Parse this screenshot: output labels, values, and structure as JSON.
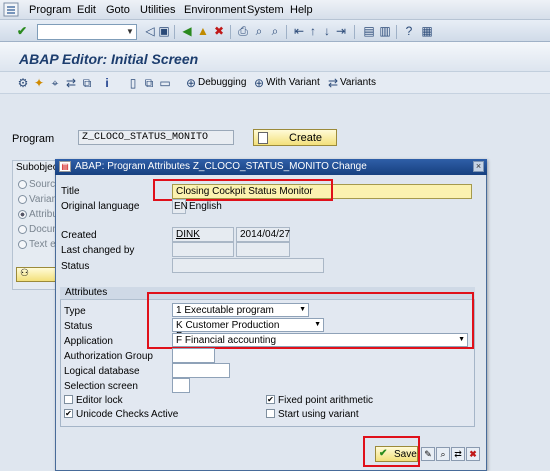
{
  "menu": [
    "Program",
    "Edit",
    "Goto",
    "Utilities",
    "Environment",
    "System",
    "Help"
  ],
  "screen_title": "ABAP Editor: Initial Screen",
  "app_toolbar": {
    "debugging": "Debugging",
    "with_variant": "With Variant",
    "variants": "Variants"
  },
  "main": {
    "program_label": "Program",
    "program_value": "Z_CLOCO_STATUS_MONITO",
    "create_label": "Create",
    "subobjects_title": "Subobject",
    "subobjects": [
      "Source",
      "Variants",
      "Attributes",
      "Documentation",
      "Text elements"
    ],
    "selected_subobject": "Attributes"
  },
  "dialog": {
    "title": "ABAP: Program Attributes Z_CLOCO_STATUS_MONITO Change",
    "title_label": "Title",
    "title_value": "Closing Cockpit Status Monitor",
    "orig_lang_label": "Original language",
    "orig_lang_code": "EN",
    "orig_lang_name": "English",
    "created_label": "Created",
    "created_by": "DINK",
    "created_date": "2014/04/27",
    "last_changed_label": "Last changed by",
    "status_label": "Status",
    "attributes_header": "Attributes",
    "type_label": "Type",
    "type_value": "1 Executable program",
    "status2_label": "Status",
    "status2_value": "K Customer Production Program",
    "application_label": "Application",
    "application_value": "F Financial accounting",
    "auth_group_label": "Authorization Group",
    "logical_db_label": "Logical database",
    "selection_screen_label": "Selection screen",
    "editor_lock_label": "Editor lock",
    "editor_lock_checked": false,
    "fixed_point_label": "Fixed point arithmetic",
    "fixed_point_checked": true,
    "unicode_label": "Unicode Checks Active",
    "unicode_checked": true,
    "start_variant_label": "Start using variant",
    "start_variant_checked": false,
    "save_label": "Save"
  },
  "colors": {
    "highlight": "#e0101a",
    "dialog_titlebar": "#1f4c92",
    "button_yellow": "#f3e07a"
  }
}
